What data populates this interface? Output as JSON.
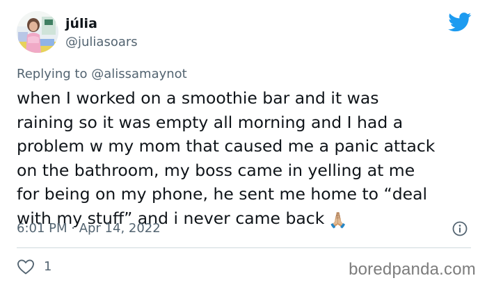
{
  "author": {
    "name": "júlia",
    "handle": "@juliasoars"
  },
  "reply": {
    "prefix": "Replying to",
    "mention": "@alissamaynot"
  },
  "tweet": {
    "lines": [
      "when I worked on a smoothie bar and it was",
      "raining so it was empty all morning and I had a",
      "problem w my mom that caused me a panic attack",
      "on the bathroom, my boss came in yelling at me",
      "for being on my phone, he sent me home to “deal",
      "with my stuff” and i never came back"
    ],
    "emoji": "🙏🏼"
  },
  "meta": {
    "timestamp": "6:01 PM · Apr 14, 2022"
  },
  "actions": {
    "like_count": "1"
  },
  "watermark": "boredpanda.com",
  "icons": {
    "brand": "twitter-bird-icon",
    "info": "info-icon",
    "like": "heart-icon"
  },
  "colors": {
    "brand_blue": "#1d9bf0",
    "text_primary": "#0f1419",
    "text_secondary": "#536471",
    "divider": "#cfd9de",
    "watermark": "#7c7c7c"
  }
}
